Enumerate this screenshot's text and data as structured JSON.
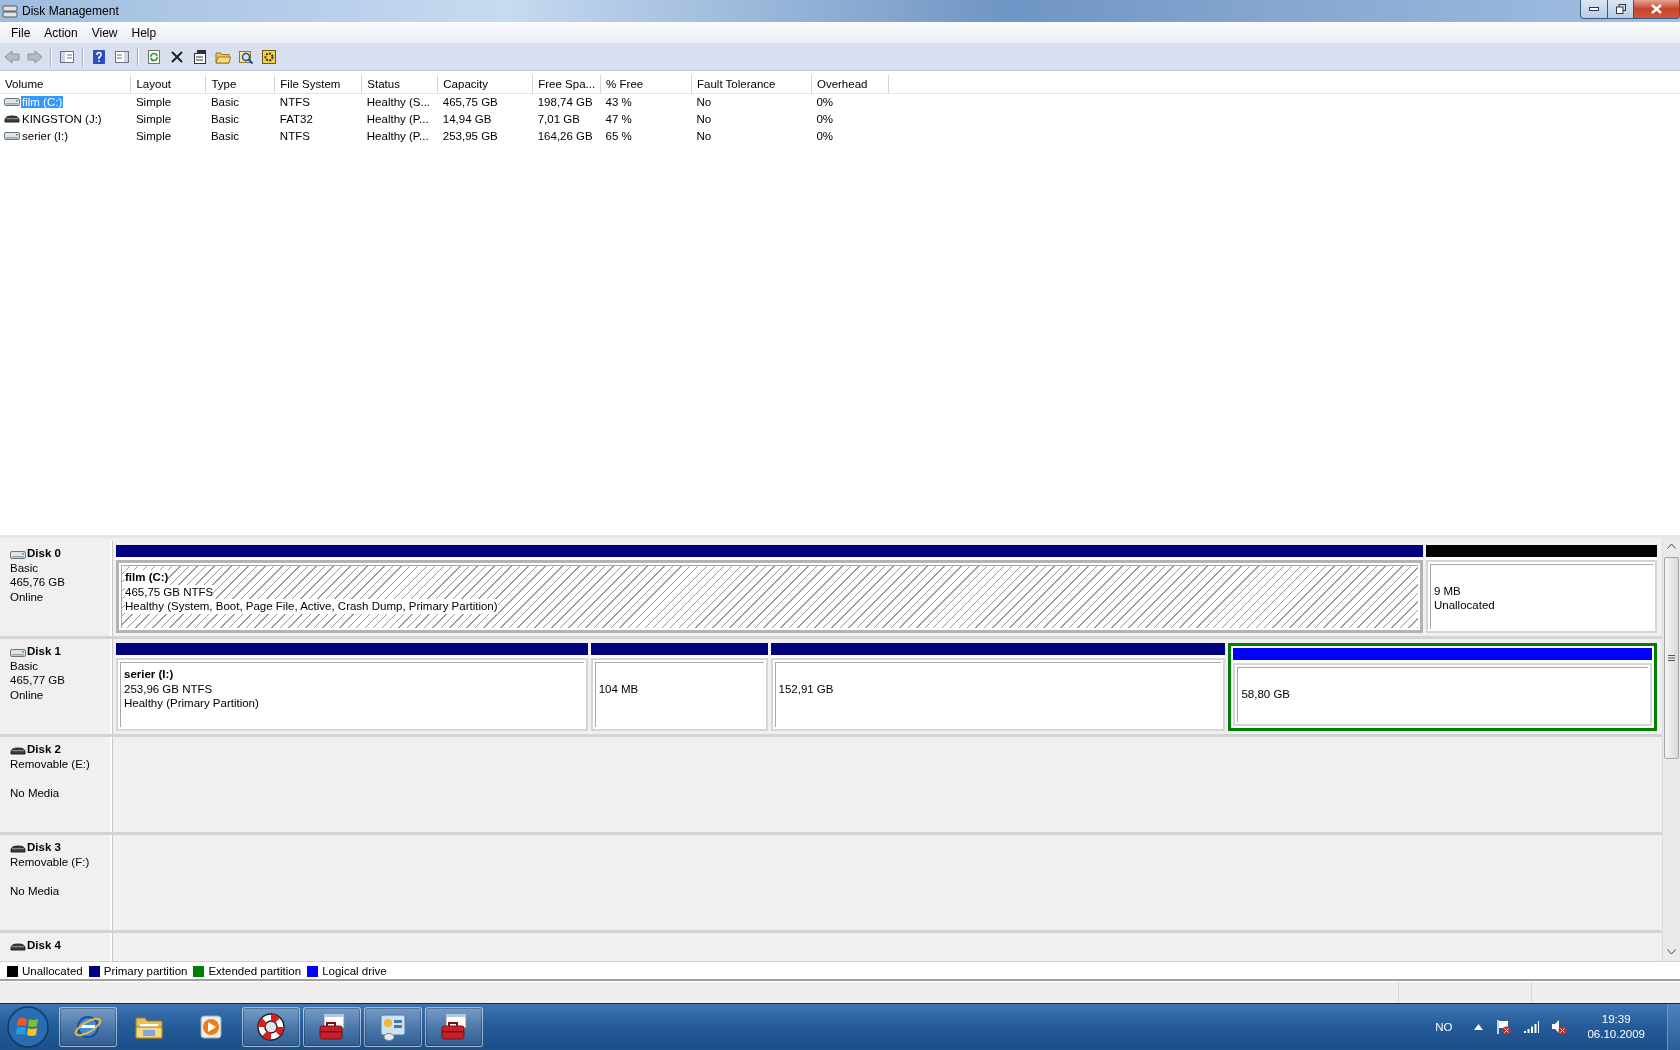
{
  "window": {
    "title": "Disk Management"
  },
  "menu": [
    "File",
    "Action",
    "View",
    "Help"
  ],
  "volumes": {
    "columns": [
      "Volume",
      "Layout",
      "Type",
      "File System",
      "Status",
      "Capacity",
      "Free Spa...",
      "% Free",
      "Fault Tolerance",
      "Overhead"
    ],
    "rows": [
      {
        "kind": "fixed",
        "selected": true,
        "cells": [
          "film (C:)",
          "Simple",
          "Basic",
          "NTFS",
          "Healthy (S...",
          "465,75 GB",
          "198,74 GB",
          "43 %",
          "No",
          "0%"
        ]
      },
      {
        "kind": "removable",
        "selected": false,
        "cells": [
          "KINGSTON (J:)",
          "Simple",
          "Basic",
          "FAT32",
          "Healthy (P...",
          "14,94 GB",
          "7,01 GB",
          "47 %",
          "No",
          "0%"
        ]
      },
      {
        "kind": "fixed",
        "selected": false,
        "cells": [
          "serier (I:)",
          "Simple",
          "Basic",
          "NTFS",
          "Healthy (P...",
          "253,95 GB",
          "164,26 GB",
          "65 %",
          "No",
          "0%"
        ]
      }
    ]
  },
  "disks": [
    {
      "kind": "fixed",
      "name": "Disk 0",
      "type": "Basic",
      "size": "465,76 GB",
      "status": "Online",
      "partitions": [
        {
          "kind": "primary",
          "selected": true,
          "name": "film  (C:)",
          "size": "465,75 GB NTFS",
          "status": "Healthy (System, Boot, Page File, Active, Crash Dump, Primary Partition)"
        },
        {
          "kind": "unallocated",
          "selected": false,
          "size": "9 MB",
          "status": "Unallocated"
        }
      ]
    },
    {
      "kind": "fixed",
      "name": "Disk 1",
      "type": "Basic",
      "size": "465,77 GB",
      "status": "Online",
      "partitions": [
        {
          "kind": "primary",
          "selected": false,
          "name": "serier  (I:)",
          "size": "253,96 GB NTFS",
          "status": "Healthy (Primary Partition)"
        },
        {
          "kind": "primary",
          "selected": false,
          "size": "104 MB"
        },
        {
          "kind": "primary",
          "selected": false,
          "size": "152,91 GB"
        },
        {
          "kind": "logical",
          "selected": false,
          "size": "58,80 GB"
        }
      ]
    },
    {
      "kind": "removable",
      "name": "Disk 2",
      "type": "Removable (E:)",
      "status": "No Media"
    },
    {
      "kind": "removable",
      "name": "Disk 3",
      "type": "Removable (F:)",
      "status": "No Media"
    },
    {
      "kind": "removable",
      "name": "Disk 4"
    }
  ],
  "legend": [
    {
      "label": "Unallocated",
      "color": "#000000"
    },
    {
      "label": "Primary partition",
      "color": "#000080"
    },
    {
      "label": "Extended partition",
      "color": "#008000"
    },
    {
      "label": "Logical drive",
      "color": "#0000ff"
    }
  ],
  "taskbar": {
    "buttons": [
      {
        "kind": "browser",
        "open": true
      },
      {
        "kind": "folder",
        "open": false
      },
      {
        "kind": "media",
        "open": false
      },
      {
        "kind": "lifebuoy",
        "open": true
      },
      {
        "kind": "toolbox",
        "open": true
      },
      {
        "kind": "panel",
        "open": true
      },
      {
        "kind": "toolbox",
        "open": true
      }
    ],
    "language": "NO",
    "time": "19:39",
    "date": "06.10.2009"
  }
}
